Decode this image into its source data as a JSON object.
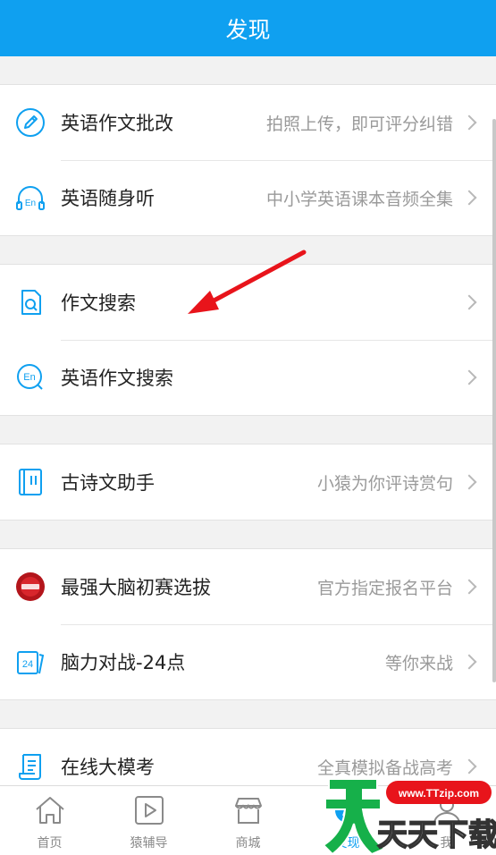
{
  "header": {
    "title": "发现"
  },
  "groups": [
    {
      "items": [
        {
          "icon": "pencil-icon",
          "title": "英语作文批改",
          "subtitle": "拍照上传，即可评分纠错"
        },
        {
          "icon": "headphones-en-icon",
          "title": "英语随身听",
          "subtitle": "中小学英语课本音频全集"
        }
      ]
    },
    {
      "items": [
        {
          "icon": "document-search-icon",
          "title": "作文搜索",
          "subtitle": ""
        },
        {
          "icon": "en-search-icon",
          "title": "英语作文搜索",
          "subtitle": ""
        }
      ]
    },
    {
      "items": [
        {
          "icon": "book-icon",
          "title": "古诗文助手",
          "subtitle": "小猿为你评诗赏句"
        }
      ]
    },
    {
      "items": [
        {
          "icon": "brain-logo-icon",
          "title": "最强大脑初赛选拔",
          "subtitle": "官方指定报名平台"
        },
        {
          "icon": "cards-24-icon",
          "title": "脑力对战-24点",
          "subtitle": "等你来战"
        }
      ]
    },
    {
      "items": [
        {
          "icon": "scroll-icon",
          "title": "在线大模考",
          "subtitle": "全真模拟备战高考"
        }
      ]
    }
  ],
  "tabbar": {
    "tabs": [
      {
        "label": "首页",
        "icon": "home-icon",
        "active": false
      },
      {
        "label": "猿辅导",
        "icon": "play-icon",
        "active": false
      },
      {
        "label": "商城",
        "icon": "store-icon",
        "active": false
      },
      {
        "label": "发现",
        "icon": "discover-icon",
        "active": true
      },
      {
        "label": "我",
        "icon": "user-icon",
        "active": false
      }
    ]
  },
  "watermark": {
    "text": "天天下载",
    "url": "www.TTzip.com"
  },
  "colors": {
    "primary": "#0fa0f0",
    "arrow": "#e8141b"
  }
}
